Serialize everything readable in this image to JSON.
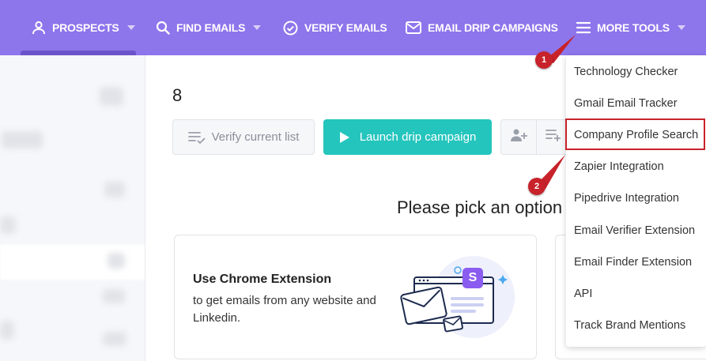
{
  "nav": {
    "prospects": "PROSPECTS",
    "find_emails": "FIND EMAILS",
    "verify_emails": "VERIFY EMAILS",
    "drip_campaigns": "EMAIL DRIP CAMPAIGNS",
    "more_tools": "MORE TOOLS"
  },
  "main": {
    "count": "8",
    "verify_label": "Verify current list",
    "launch_label": "Launch drip campaign",
    "pick_heading": "Please pick an option",
    "card": {
      "title": "Use Chrome Extension",
      "text": "to get emails from any website and Linkedin.",
      "badge": "S"
    }
  },
  "dropdown": {
    "items": [
      "Technology Checker",
      "Gmail Email Tracker",
      "Company Profile Search",
      "Zapier Integration",
      "Pipedrive Integration",
      "Email Verifier Extension",
      "Email Finder Extension",
      "API",
      "Track Brand Mentions"
    ]
  },
  "annotations": {
    "marker1": "1",
    "marker2": "2"
  },
  "colors": {
    "nav_bg": "#8d75eb",
    "accent_teal": "#24c5bd",
    "highlight_red": "#c8222a"
  }
}
